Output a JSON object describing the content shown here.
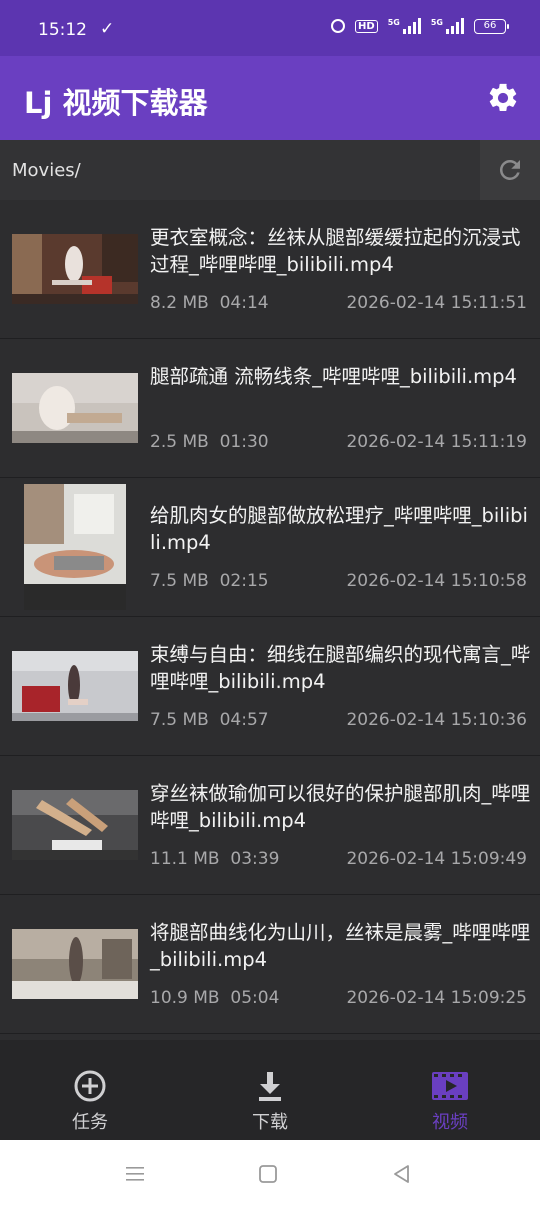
{
  "status_bar": {
    "time": "15:12",
    "hd": "HD",
    "sig1_label": "5G",
    "sig2_label": "5G",
    "battery": "66"
  },
  "app_bar": {
    "title": "Lj 视频下载器"
  },
  "path_bar": {
    "path": "Movies/"
  },
  "videos": [
    {
      "title": "更衣室概念：丝袜从腿部缓缓拉起的沉浸式过程_哔哩哔哩_bilibili.mp4",
      "size": "8.2 MB",
      "duration": "04:14",
      "date": "2026-02-14 15:11:51"
    },
    {
      "title": "腿部疏通 流畅线条_哔哩哔哩_bilibili.mp4",
      "size": "2.5 MB",
      "duration": "01:30",
      "date": "2026-02-14 15:11:19"
    },
    {
      "title": "给肌肉女的腿部做放松理疗_哔哩哔哩_bilibili.mp4",
      "size": "7.5 MB",
      "duration": "02:15",
      "date": "2026-02-14 15:10:58"
    },
    {
      "title": "束缚与自由：细线在腿部编织的现代寓言_哔哩哔哩_bilibili.mp4",
      "size": "7.5 MB",
      "duration": "04:57",
      "date": "2026-02-14 15:10:36"
    },
    {
      "title": "穿丝袜做瑜伽可以很好的保护腿部肌肉_哔哩哔哩_bilibili.mp4",
      "size": "11.1 MB",
      "duration": "03:39",
      "date": "2026-02-14 15:09:49"
    },
    {
      "title": "将腿部曲线化为山川，丝袜是晨雾_哔哩哔哩_bilibili.mp4",
      "size": "10.9 MB",
      "duration": "05:04",
      "date": "2026-02-14 15:09:25"
    }
  ],
  "bottom_nav": [
    {
      "label": "任务",
      "icon": "add-circle-icon",
      "active": false
    },
    {
      "label": "下载",
      "icon": "download-icon",
      "active": false
    },
    {
      "label": "视频",
      "icon": "video-icon",
      "active": true
    }
  ],
  "colors": {
    "accent": "#6a3fc1",
    "nav_active": "#6a3fc1",
    "background": "#2d2d2f"
  }
}
